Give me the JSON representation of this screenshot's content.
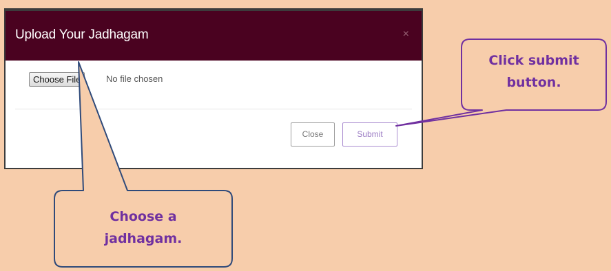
{
  "modal": {
    "title": "Upload Your Jadhagam",
    "close_symbol": "×",
    "file_input": {
      "button_label": "Choose File",
      "status_text": "No file chosen"
    },
    "buttons": {
      "close_label": "Close",
      "submit_label": "Submit"
    }
  },
  "callouts": {
    "submit_hint_line1": "Click submit",
    "submit_hint_line2": "button.",
    "choose_hint_line1": "Choose a",
    "choose_hint_line2": "jadhagam."
  },
  "colors": {
    "background": "#f7cdab",
    "header": "#4a0220",
    "callout_text": "#7030a0",
    "callout_border": "#2f4a7a"
  }
}
